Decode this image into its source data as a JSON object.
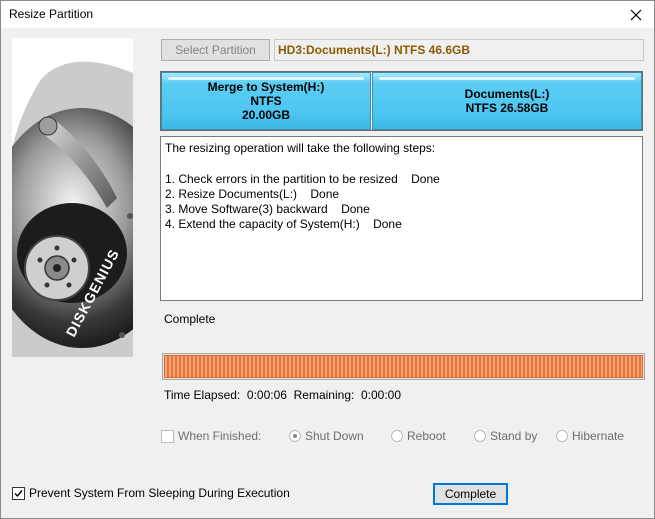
{
  "window": {
    "title": "Resize Partition"
  },
  "brand": {
    "logo_text": "DISKGENIUS"
  },
  "toolbar": {
    "select_partition_label": "Select Partition",
    "disk_info": "HD3:Documents(L:) NTFS 46.6GB"
  },
  "partitions": [
    {
      "name": "Merge to System(H:)",
      "fs": "NTFS",
      "size": "20.00GB"
    },
    {
      "name": "Documents(L:)",
      "fs_size": "NTFS 26.58GB"
    }
  ],
  "log": {
    "lines": [
      "The resizing operation will take the following steps:",
      "",
      "1. Check errors in the partition to be resized    Done",
      "2. Resize Documents(L:)    Done",
      "3. Move Software(3) backward    Done",
      "4. Extend the capacity of System(H:)    Done"
    ]
  },
  "status": {
    "label": "Complete",
    "progress_percent": 100,
    "time_text": "Time Elapsed:  0:00:06  Remaining:  0:00:00"
  },
  "options": {
    "when_finished_label": "When Finished:",
    "when_finished_checked": false,
    "choices": [
      "Shut Down",
      "Reboot",
      "Stand by",
      "Hibernate"
    ],
    "selected": "Shut Down"
  },
  "footer": {
    "prevent_sleep_label": "Prevent System From Sleeping During Execution",
    "prevent_sleep_checked": true,
    "complete_button": "Complete"
  },
  "colors": {
    "partition_fill": "#4dc6f0",
    "progress_fill": "#f08a4b",
    "disk_info_text": "#8a5a00",
    "default_button_border": "#0078d7"
  }
}
